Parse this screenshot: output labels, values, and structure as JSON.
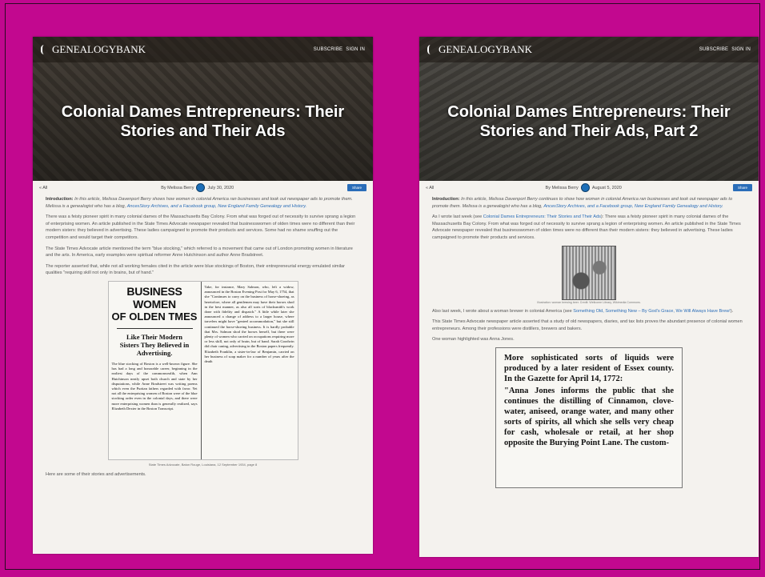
{
  "left": {
    "logo": "GENEALOGYBANK",
    "nav": [
      "SUBSCRIBE",
      "SIGN IN"
    ],
    "title": "Colonial Dames Entrepreneurs: Their Stories and Their Ads",
    "back": "« All",
    "byline": "By Melissa Berry",
    "date": "July 30, 2020",
    "share": "Share",
    "intro_label": "Introduction:",
    "intro": "In this article, Melissa Davenport Berry shows how women in colonial America ran businesses and took out newspaper ads to promote them. Melissa is a genealogist who has a blog,",
    "intro_links": "AncesStory Archives, and a Facebook group, New England Family Genealogy and History.",
    "p1": "There was a feisty pioneer spirit in many colonial dames of the Massachusetts Bay Colony. From what was forged out of necessity to survive sprang a legion of enterprising women. An article published in the State Times Advocate newspaper revealed that businesswomen of olden times were no different than their modern sisters: they believed in advertising. These ladies campaigned to promote their products and services. Some had no shame snuffing out the competition and would target their competitors.",
    "p2": "The State Times Advocate article mentioned the term \"blue stocking,\" which referred to a movement that came out of London promoting women in literature and the arts. In America, early examples were spiritual reformer Anne Hutchinson and author Anne Bradstreet.",
    "p3": "The reporter asserted that, while not all working females cited in the article were blue stockings of Boston, their entrepreneurial energy emulated similar qualities \"requiring skill not only in brains, but of hand.\"",
    "clip_head1": "BUSINESS WOMEN",
    "clip_head2": "OF OLDEN TMES",
    "clip_sub": "Like Their Modern Sisters They Believed in Advertising.",
    "clip_c1": "The blue stocking of Boston is a well-known figure. She has had a long and honorable career, beginning in the earliest days of the commonwealth, when Ann Hutchinson neatly upset both church and state by her disputations, while Anne Bradstreet was writing poems which even the Puritan fathers regarded with favor. Yet not all the enterprising women of Boston were of the blue stocking order even in the colonial days, and there were more enterprising women than is generally realized, says Elizabeth Dexter in the Boston Transcript.",
    "clip_c2": "Take, for instance, Mary Salmon, who, left a widow, announced in the Boston Evening Post for May 6, 1754, that she \"Continues to carry on the business of horse-shoeing, as heretofore, where all gentlemen may have their horses shod in the best manner, as also all sorts of blacksmith's work done with fidelity and dispatch.\" A little while later she announced a change of address to a larger house, where travelers might have \"genteel accommodation,\" but she still continued the horse-shoeing business. It is hardly probable that Mrs. Salmon shod the horses herself, but there were plenty of women who carried on occupations requiring more or less skill, not only of brain, but of hand. Sarah Goodwin did chair caning, advertising in the Boston papers frequently. Elizabeth Franklin, a sister-in-law of Benjamin, carried on her business of soap maker for a number of years after the death",
    "clip_caption": "State Times Advocate, Baton Rouge, Louisiana, 12 September 1934, page 8",
    "closing": "Here are some of their stories and advertisements."
  },
  "right": {
    "logo": "GENEALOGYBANK",
    "nav": [
      "SUBSCRIBE",
      "SIGN IN"
    ],
    "title": "Colonial Dames Entrepreneurs: Their Stories and Their Ads, Part 2",
    "back": "« All",
    "byline": "By Melissa Berry",
    "date": "August 5, 2020",
    "share": "Share",
    "intro_label": "Introduction:",
    "intro": "In this article, Melissa Davenport Berry continues to show how women in colonial America ran businesses and took out newspaper ads to promote them. Melissa is a genealogist who has a blog,",
    "intro_links": "AncesStory Archives, and a Facebook group, New England Family Genealogy and History.",
    "p1_lead": "As I wrote last week (see",
    "p1_link": "Colonial Dames Entrepreneurs: Their Stories and Their Ads",
    "p1": "): There was a feisty pioneer spirit in many colonial dames of the Massachusetts Bay Colony. From what was forged out of necessity to survive sprang a legion of enterprising women. An article published in the State Times Advocate newspaper revealed that businesswomen of olden times were no different than their modern sisters: they believed in advertising. These ladies campaigned to promote their products and services.",
    "illus_caption": "Illustration: woman brewing beer. Credit: Wellcome Library, Wikimedia Commons.",
    "p2_lead": "Also last week, I wrote about a woman brewer in colonial America (see",
    "p2_link": "Something Old, Something New – By God's Grace, We Will Always Have Brew!",
    "p2_end": ").",
    "p3": "This State Times Advocate newspaper article asserted that a study of old newspapers, diaries, and tax lists proves the abundant presence of colonial women entrepreneurs. Among their professions were distillers, brewers and bakers.",
    "p4": "One woman highlighted was Anna Jones.",
    "clip_l1": "More sophisticated sorts of liquids were produced by a later resident of Essex county. In the Gazette for April 14, 1772:",
    "clip_l2": "\"Anna Jones informs the public that she continues the distilling of Cinnamon, clove-water, aniseed, orange water, and many other sorts of spirits, all which she sells very cheap for cash, wholesale or retail, at her shop opposite the Burying Point Lane. The custom-"
  }
}
